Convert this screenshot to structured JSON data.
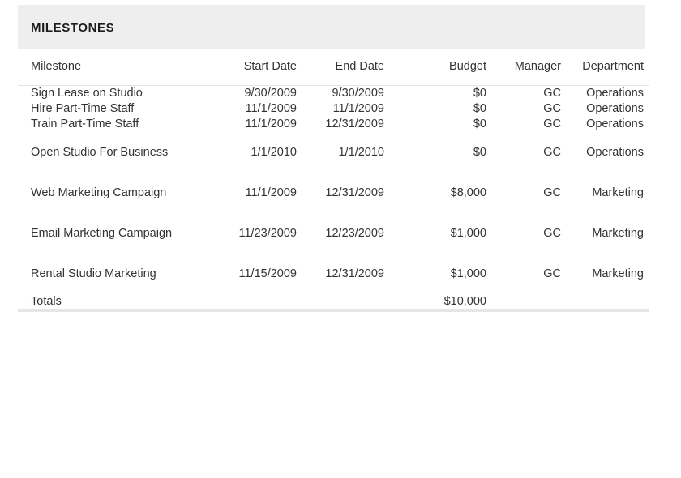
{
  "section": {
    "title": "MILESTONES"
  },
  "table": {
    "columns": [
      {
        "key": "milestone",
        "label": "Milestone",
        "align": "left"
      },
      {
        "key": "start_date",
        "label": "Start Date",
        "align": "right"
      },
      {
        "key": "end_date",
        "label": "End Date",
        "align": "right"
      },
      {
        "key": "budget",
        "label": "Budget",
        "align": "right"
      },
      {
        "key": "manager",
        "label": "Manager",
        "align": "right"
      },
      {
        "key": "department",
        "label": "Department",
        "align": "right"
      }
    ],
    "rows": [
      {
        "milestone": "Sign Lease on Studio",
        "start_date": "9/30/2009",
        "end_date": "9/30/2009",
        "budget": "$0",
        "manager": "GC",
        "department": "Operations"
      },
      {
        "milestone": "Hire Part-Time Staff",
        "start_date": "11/1/2009",
        "end_date": "11/1/2009",
        "budget": "$0",
        "manager": "GC",
        "department": "Operations"
      },
      {
        "milestone": "Train Part-Time Staff",
        "start_date": "11/1/2009",
        "end_date": "12/31/2009",
        "budget": "$0",
        "manager": "GC",
        "department": "Operations"
      },
      {
        "milestone": "Open Studio For Business",
        "start_date": "1/1/2010",
        "end_date": "1/1/2010",
        "budget": "$0",
        "manager": "GC",
        "department": "Operations"
      },
      {
        "milestone": "Web Marketing Campaign",
        "start_date": "11/1/2009",
        "end_date": "12/31/2009",
        "budget": "$8,000",
        "manager": "GC",
        "department": "Marketing"
      },
      {
        "milestone": "Email Marketing Campaign",
        "start_date": "11/23/2009",
        "end_date": "12/23/2009",
        "budget": "$1,000",
        "manager": "GC",
        "department": "Marketing"
      },
      {
        "milestone": "Rental Studio Marketing",
        "start_date": "11/15/2009",
        "end_date": "12/31/2009",
        "budget": "$1,000",
        "manager": "GC",
        "department": "Marketing"
      }
    ],
    "totals": {
      "label": "Totals",
      "start_date": "",
      "end_date": "",
      "budget": "$10,000",
      "manager": "",
      "department": ""
    }
  },
  "colors": {
    "header_band": "#eeeeee",
    "text": "#333333",
    "title_text": "#1c1c1c",
    "divider": "#e4e4e4",
    "bottom_rule": "#e6e6e6",
    "background": "#ffffff"
  }
}
